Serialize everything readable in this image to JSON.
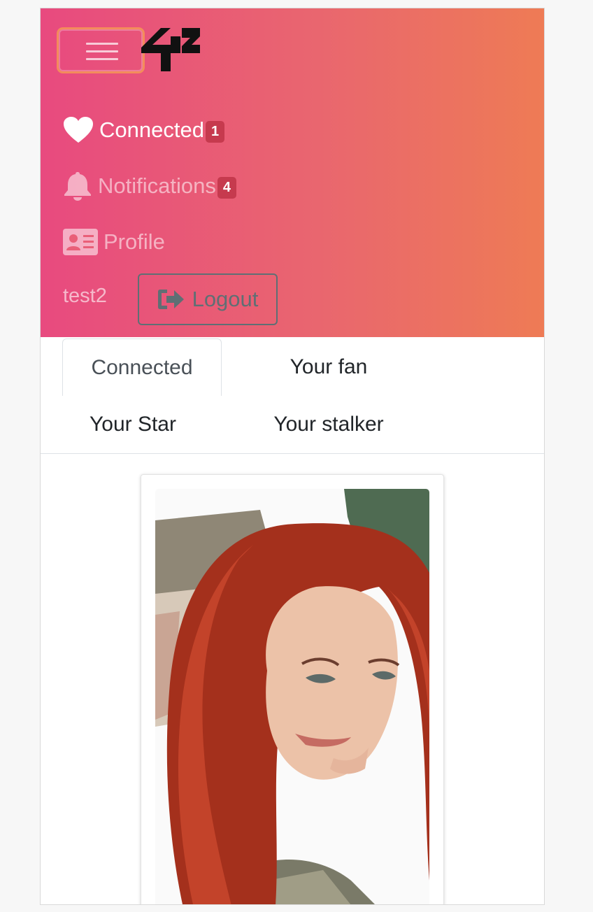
{
  "navbar": {
    "menu_toggle": "menu",
    "logo_text": "42",
    "items": [
      {
        "label": "Connected",
        "badge": "1",
        "icon": "heart-icon"
      },
      {
        "label": "Notifications",
        "badge": "4",
        "icon": "bell-icon"
      },
      {
        "label": "Profile",
        "icon": "id-card-icon"
      }
    ],
    "username": "test2",
    "logout_label": "Logout"
  },
  "tabs": [
    {
      "label": "Connected",
      "active": true
    },
    {
      "label": "Your fan"
    },
    {
      "label": "Your Star"
    },
    {
      "label": "Your stalker"
    }
  ],
  "card": {
    "photo": "profile-photo"
  },
  "colors": {
    "gradient_start": "#e84a7f",
    "gradient_end": "#ee7b55",
    "badge": "#c63a4e",
    "logout_outline": "#5f6f74"
  }
}
